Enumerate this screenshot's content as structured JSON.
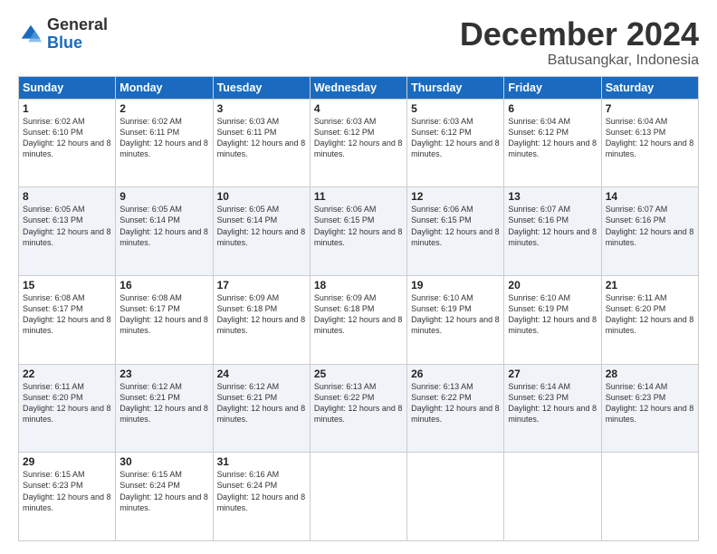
{
  "logo": {
    "general": "General",
    "blue": "Blue"
  },
  "title": "December 2024",
  "location": "Batusangkar, Indonesia",
  "days_of_week": [
    "Sunday",
    "Monday",
    "Tuesday",
    "Wednesday",
    "Thursday",
    "Friday",
    "Saturday"
  ],
  "weeks": [
    [
      {
        "day": "1",
        "sunrise": "6:02 AM",
        "sunset": "6:10 PM",
        "daylight": "12 hours and 8 minutes."
      },
      {
        "day": "2",
        "sunrise": "6:02 AM",
        "sunset": "6:11 PM",
        "daylight": "12 hours and 8 minutes."
      },
      {
        "day": "3",
        "sunrise": "6:03 AM",
        "sunset": "6:11 PM",
        "daylight": "12 hours and 8 minutes."
      },
      {
        "day": "4",
        "sunrise": "6:03 AM",
        "sunset": "6:12 PM",
        "daylight": "12 hours and 8 minutes."
      },
      {
        "day": "5",
        "sunrise": "6:03 AM",
        "sunset": "6:12 PM",
        "daylight": "12 hours and 8 minutes."
      },
      {
        "day": "6",
        "sunrise": "6:04 AM",
        "sunset": "6:12 PM",
        "daylight": "12 hours and 8 minutes."
      },
      {
        "day": "7",
        "sunrise": "6:04 AM",
        "sunset": "6:13 PM",
        "daylight": "12 hours and 8 minutes."
      }
    ],
    [
      {
        "day": "8",
        "sunrise": "6:05 AM",
        "sunset": "6:13 PM",
        "daylight": "12 hours and 8 minutes."
      },
      {
        "day": "9",
        "sunrise": "6:05 AM",
        "sunset": "6:14 PM",
        "daylight": "12 hours and 8 minutes."
      },
      {
        "day": "10",
        "sunrise": "6:05 AM",
        "sunset": "6:14 PM",
        "daylight": "12 hours and 8 minutes."
      },
      {
        "day": "11",
        "sunrise": "6:06 AM",
        "sunset": "6:15 PM",
        "daylight": "12 hours and 8 minutes."
      },
      {
        "day": "12",
        "sunrise": "6:06 AM",
        "sunset": "6:15 PM",
        "daylight": "12 hours and 8 minutes."
      },
      {
        "day": "13",
        "sunrise": "6:07 AM",
        "sunset": "6:16 PM",
        "daylight": "12 hours and 8 minutes."
      },
      {
        "day": "14",
        "sunrise": "6:07 AM",
        "sunset": "6:16 PM",
        "daylight": "12 hours and 8 minutes."
      }
    ],
    [
      {
        "day": "15",
        "sunrise": "6:08 AM",
        "sunset": "6:17 PM",
        "daylight": "12 hours and 8 minutes."
      },
      {
        "day": "16",
        "sunrise": "6:08 AM",
        "sunset": "6:17 PM",
        "daylight": "12 hours and 8 minutes."
      },
      {
        "day": "17",
        "sunrise": "6:09 AM",
        "sunset": "6:18 PM",
        "daylight": "12 hours and 8 minutes."
      },
      {
        "day": "18",
        "sunrise": "6:09 AM",
        "sunset": "6:18 PM",
        "daylight": "12 hours and 8 minutes."
      },
      {
        "day": "19",
        "sunrise": "6:10 AM",
        "sunset": "6:19 PM",
        "daylight": "12 hours and 8 minutes."
      },
      {
        "day": "20",
        "sunrise": "6:10 AM",
        "sunset": "6:19 PM",
        "daylight": "12 hours and 8 minutes."
      },
      {
        "day": "21",
        "sunrise": "6:11 AM",
        "sunset": "6:20 PM",
        "daylight": "12 hours and 8 minutes."
      }
    ],
    [
      {
        "day": "22",
        "sunrise": "6:11 AM",
        "sunset": "6:20 PM",
        "daylight": "12 hours and 8 minutes."
      },
      {
        "day": "23",
        "sunrise": "6:12 AM",
        "sunset": "6:21 PM",
        "daylight": "12 hours and 8 minutes."
      },
      {
        "day": "24",
        "sunrise": "6:12 AM",
        "sunset": "6:21 PM",
        "daylight": "12 hours and 8 minutes."
      },
      {
        "day": "25",
        "sunrise": "6:13 AM",
        "sunset": "6:22 PM",
        "daylight": "12 hours and 8 minutes."
      },
      {
        "day": "26",
        "sunrise": "6:13 AM",
        "sunset": "6:22 PM",
        "daylight": "12 hours and 8 minutes."
      },
      {
        "day": "27",
        "sunrise": "6:14 AM",
        "sunset": "6:23 PM",
        "daylight": "12 hours and 8 minutes."
      },
      {
        "day": "28",
        "sunrise": "6:14 AM",
        "sunset": "6:23 PM",
        "daylight": "12 hours and 8 minutes."
      }
    ],
    [
      {
        "day": "29",
        "sunrise": "6:15 AM",
        "sunset": "6:23 PM",
        "daylight": "12 hours and 8 minutes."
      },
      {
        "day": "30",
        "sunrise": "6:15 AM",
        "sunset": "6:24 PM",
        "daylight": "12 hours and 8 minutes."
      },
      {
        "day": "31",
        "sunrise": "6:16 AM",
        "sunset": "6:24 PM",
        "daylight": "12 hours and 8 minutes."
      },
      null,
      null,
      null,
      null
    ]
  ],
  "labels": {
    "sunrise_prefix": "Sunrise: ",
    "sunset_prefix": "Sunset: ",
    "daylight_prefix": "Daylight: "
  }
}
